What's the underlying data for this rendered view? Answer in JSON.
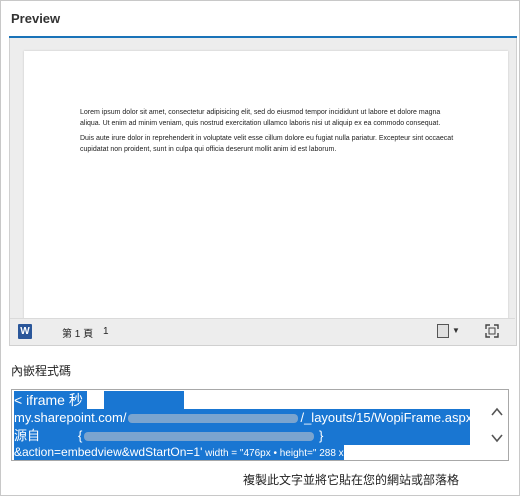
{
  "header": {
    "title": "Preview"
  },
  "document": {
    "paragraph1": "Lorem ipsum dolor sit amet, consectetur adipisicing elit, sed do eiusmod tempor incididunt ut labore et dolore magna aliqua. Ut enim ad minim veniam, quis nostrud exercitation ullamco laboris nisi ut aliquip ex ea commodo consequat.",
    "paragraph2": "Duis aute irure dolor in reprehenderit in voluptate velit esse cillum dolore eu fugiat nulla pariatur. Excepteur sint occaecat cupidatat non proident, sunt in culpa qui officia deserunt mollit anim id est laborum."
  },
  "statusbar": {
    "app_icon": "word-icon",
    "app_letter": "W",
    "page_label": "第 1 頁",
    "page_count": "1"
  },
  "embed": {
    "label": "內嵌程式碼",
    "code_line1": "< iframe 秒",
    "code_line2_a": "my.sharepoint.com/",
    "code_line2_b": "/_layouts/15/WopiFrame.aspx?",
    "code_line3": "源自",
    "code_line3_b": "{",
    "code_line3_c": "}",
    "code_line4_a": "&action=embedview&wdStartOn=1'",
    "code_line4_b": " width = \"476px • height=\" 288 x",
    "hint": "複製此文字並將它貼在您的網站或部落格"
  },
  "colors": {
    "accent": "#1a73b8",
    "selection": "#1976d2",
    "word": "#2b579a"
  }
}
